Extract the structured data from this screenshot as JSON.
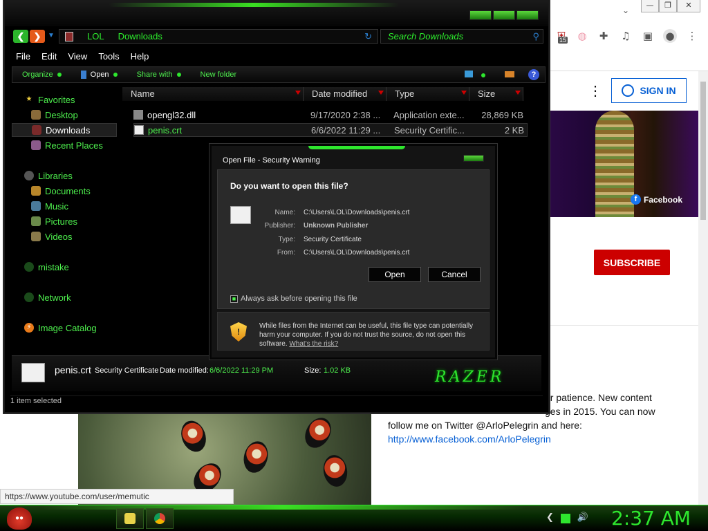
{
  "browser": {
    "window_controls": {
      "minimize": "—",
      "restore": "❐",
      "close": "✕"
    },
    "extension_badge": "15",
    "sign_in": "SIGN IN",
    "menu_dots": "⋮",
    "banner_label": "Facebook",
    "subscribe": "SUBSCRIBE",
    "about_lines": [
      "ur patience. New content",
      "ges in 2015. You can now",
      "follow me on Twitter @ArloPelegrin and here:"
    ],
    "about_link": "http://www.facebook.com/ArloPelegrin",
    "status_url": "https://www.youtube.com/user/memutic"
  },
  "explorer": {
    "breadcrumb": [
      "LOL",
      "Downloads"
    ],
    "search_placeholder": "Search Downloads",
    "menu": [
      "File",
      "Edit",
      "View",
      "Tools",
      "Help"
    ],
    "commands": {
      "organize": "Organize",
      "open": "Open",
      "share_with": "Share with",
      "new_folder": "New folder"
    },
    "nav": {
      "favorites": "Favorites",
      "desktop": "Desktop",
      "downloads": "Downloads",
      "recent_places": "Recent Places",
      "libraries": "Libraries",
      "documents": "Documents",
      "music": "Music",
      "pictures": "Pictures",
      "videos": "Videos",
      "mistake": "mistake",
      "network": "Network",
      "image_catalog": "Image Catalog"
    },
    "columns": [
      "Name",
      "Date modified",
      "Type",
      "Size"
    ],
    "files": [
      {
        "name": "opengl32.dll",
        "date": "9/17/2020 2:38 ...",
        "type": "Application exte...",
        "size": "28,869 KB"
      },
      {
        "name": "penis.crt",
        "date": "6/6/2022 11:29 ...",
        "type": "Security Certific...",
        "size": "2 KB"
      }
    ],
    "details": {
      "name": "penis.crt",
      "type": "Security Certificate",
      "modified_label": "Date modified:",
      "modified": "6/6/2022 11:29 PM",
      "size_label": "Size:",
      "size": "1.02 KB",
      "brand": "RAZER"
    },
    "status": "1 item selected"
  },
  "dialog": {
    "title": "Open File - Security Warning",
    "question": "Do you want to open this file?",
    "labels": {
      "name": "Name:",
      "publisher": "Publisher:",
      "type": "Type:",
      "from": "From:"
    },
    "values": {
      "name": "C:\\Users\\LOL\\Downloads\\penis.crt",
      "publisher": "Unknown Publisher",
      "type": "Security Certificate",
      "from": "C:\\Users\\LOL\\Downloads\\penis.crt"
    },
    "open_button": "Open",
    "cancel_button": "Cancel",
    "checkbox_label": "Always ask before opening this file",
    "warning_text": "While files from the Internet can be useful, this file type can potentially harm your computer. If you do not trust the source, do not open this software.",
    "warning_link": "What's the risk?"
  },
  "taskbar": {
    "clock": "2:37 AM"
  },
  "colors": {
    "accent_green": "#2ee62e",
    "youtube_red": "#cc0000",
    "link_blue": "#065fd4"
  }
}
